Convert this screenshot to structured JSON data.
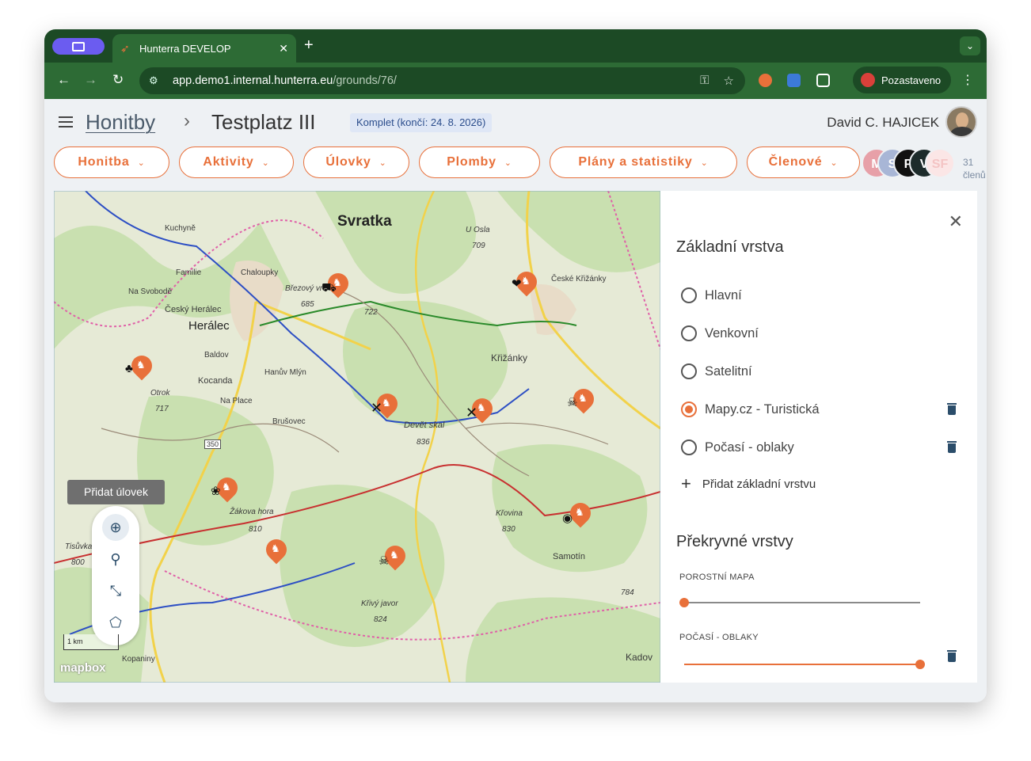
{
  "browser": {
    "tab_title": "Hunterra DEVELOP",
    "tab_close": "✕",
    "new_tab": "+",
    "url_host": "app.demo1.internal.hunterra.eu",
    "url_path": "/grounds/76/",
    "profile_status": "Pozastaveno"
  },
  "header": {
    "breadcrumb_root": "Honitby",
    "breadcrumb_separator": "›",
    "page_title": "Testplatz III",
    "license_badge": "Komplet (končí: 24. 8. 2026)",
    "user_name": "David C. HAJICEK"
  },
  "menu": {
    "items": [
      {
        "label": "Honitba"
      },
      {
        "label": "Aktivity"
      },
      {
        "label": "Úlovky"
      },
      {
        "label": "Plomby"
      },
      {
        "label": "Plány a statistiky"
      },
      {
        "label": "Členové"
      }
    ]
  },
  "members": {
    "avatars": [
      {
        "initial": "M",
        "color": "#e7a0a8"
      },
      {
        "initial": "S",
        "color": "#a8b6d6"
      },
      {
        "initial": "P",
        "color": "#111111"
      },
      {
        "initial": "V",
        "color": "#1d2b2b"
      },
      {
        "initial": "SF",
        "color": "#fbe6e6"
      }
    ],
    "count_number": "31",
    "count_label": "členů"
  },
  "map": {
    "labels": {
      "svratka": "Svratka",
      "heralec": "Herálec",
      "cesky_heralec": "Český Herálec",
      "krizanky": "Křižánky",
      "ceske_krizanky": "České Křižánky",
      "u_osla": "U Osla",
      "u_osla_elev": "709",
      "brezovy": "Březový vrch",
      "brezovy_elev": "685",
      "elev_722": "722",
      "devet_skal": "Devět skal",
      "devet_skal_elev": "836",
      "kocanda": "Kocanda",
      "otrok": "Otrok",
      "otrok_elev": "717",
      "zakova_hora": "Žákova hora",
      "zakova_elev": "810",
      "krovina": "Křovina",
      "krovina_elev": "830",
      "samotin": "Samotín",
      "krivy_javor": "Křivý javor",
      "krivy_elev": "824",
      "kadov": "Kadov",
      "kuchyne": "Kuchyně",
      "chaloupky": "Chaloupky",
      "familie": "Familie",
      "na_svobode": "Na Svobodě",
      "baldov": "Baldov",
      "na_place": "Na Place",
      "brusovec": "Brušovec",
      "hanuv_mlyn": "Hanův Mlýn",
      "road_350": "350",
      "kopaniny": "Kopaniny",
      "tisuvka": "Tisůvka",
      "tisuvka_elev": "800",
      "elev_784": "784",
      "scale": "1 km",
      "attribution": "mapbox"
    },
    "tooltip": "Přidat úlovek"
  },
  "layers": {
    "base_title": "Základní vrstva",
    "base_layers": [
      {
        "label": "Hlavní",
        "selected": false,
        "deletable": false
      },
      {
        "label": "Venkovní",
        "selected": false,
        "deletable": false
      },
      {
        "label": "Satelitní",
        "selected": false,
        "deletable": false
      },
      {
        "label": "Mapy.cz - Turistická",
        "selected": true,
        "deletable": true
      },
      {
        "label": "Počasí - oblaky",
        "selected": false,
        "deletable": true
      }
    ],
    "add_base_label": "Přidat základní vrstvu",
    "overlay_title": "Překryvné vrstvy",
    "overlays": [
      {
        "label": "POROSTNÍ MAPA",
        "opacity": 0
      },
      {
        "label": "POČASÍ - OBLAKY",
        "opacity": 1
      }
    ]
  },
  "colors": {
    "accent": "#e8703a",
    "chrome_dark": "#1c4a25",
    "chrome": "#2d6b35"
  }
}
